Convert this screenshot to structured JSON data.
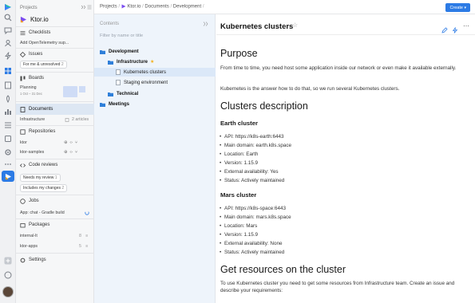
{
  "colors": {
    "accent": "#2c7be5",
    "folder": "#2f7fd9",
    "star": "#f3b11b",
    "selected_bg": "#dbe8f8"
  },
  "topbar": {
    "crumbs": [
      "Projects",
      "/",
      "Ktor.io",
      "/",
      "Documents",
      "/",
      "Development",
      "/"
    ],
    "create_label": "Create"
  },
  "sidebar": {
    "header": "Projects",
    "project_name": "Ktor.io",
    "checklists": "Checklists",
    "checklist_item": "Add OpenTelemetry sup...",
    "issues": "Issues",
    "issues_filter": "For me & unresolved",
    "issues_filter_count": "2",
    "boards": "Boards",
    "board_name": "Planning",
    "board_dates": "1 Oct – 31 Dec",
    "documents": "Documents",
    "doc_folder": "Infrastructure",
    "doc_count": "2 articles",
    "repositories": "Repositories",
    "repos": [
      "ktor",
      "ktor-samples"
    ],
    "code_reviews": "Code reviews",
    "review_filters": [
      {
        "label": "Needs my review",
        "count": "1"
      },
      {
        "label": "Includes my changes",
        "count": "2"
      }
    ],
    "jobs": "Jobs",
    "job_item": "App: chat - Gradle build",
    "packages": "Packages",
    "package_items": [
      {
        "name": "internal-lt",
        "count": "8"
      },
      {
        "name": "ktor-apps",
        "count": "5"
      }
    ],
    "settings": "Settings"
  },
  "contents": {
    "title": "Contents",
    "filter_placeholder": "Filter by name or title",
    "tree": [
      {
        "label": "Development",
        "level": 0,
        "type": "folder"
      },
      {
        "label": "Infrastructure",
        "level": 1,
        "type": "folder",
        "starred": true
      },
      {
        "label": "Kubernetes clusters",
        "level": 2,
        "type": "doc",
        "selected": true
      },
      {
        "label": "Staging environment",
        "level": 2,
        "type": "doc"
      },
      {
        "label": "Technical",
        "level": 1,
        "type": "folder"
      },
      {
        "label": "Meetings",
        "level": 0,
        "type": "folder"
      }
    ]
  },
  "document": {
    "title": "Kubernetes clusters",
    "h_purpose": "Purpose",
    "p1": "From time to time, you need host some application inside our network or even make it available externally.",
    "p2": "Kubernetes is the answer how to do that, so we run several Kubernetes clusters.",
    "h_clusters": "Clusters description",
    "earth_title": "Earth cluster",
    "earth_items": [
      "API: https://k8s-earth:6443",
      "Main domain: earth.k8s.space",
      "Location: Earth",
      "Version: 1.15.9",
      "External availability: Yes",
      "Status: Actively maintained"
    ],
    "mars_title": "Mars cluster",
    "mars_items": [
      "API: https://k8s-space:6443",
      "Main domain: mars.k8s.space",
      "Location: Mars",
      "Version: 1.15.9",
      "External availability: None",
      "Status: Actively maintained"
    ],
    "h_resources": "Get resources on the cluster",
    "p3": "To use Kubernetes cluster you need to get some resources from Infrastructure team. Create an issue and describe your requirements:"
  }
}
